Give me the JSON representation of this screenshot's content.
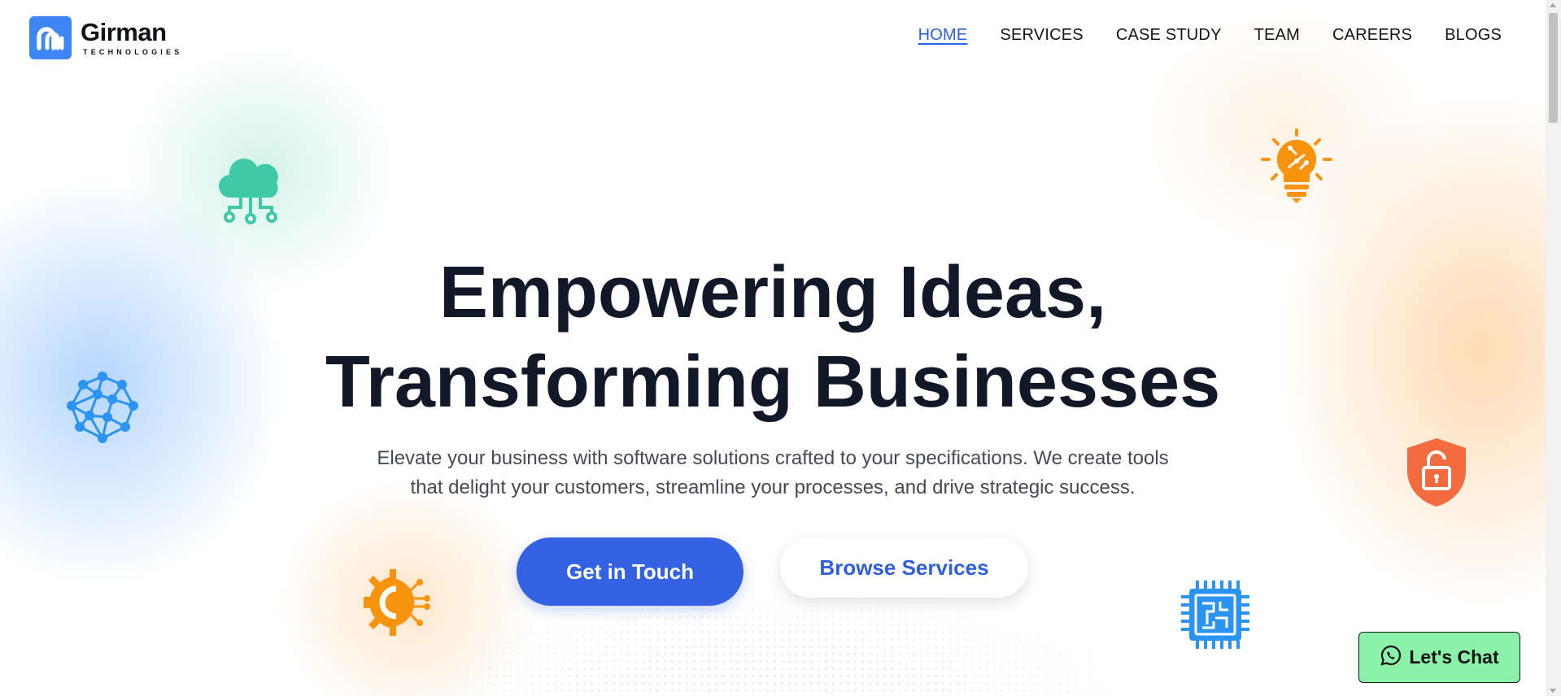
{
  "brand": {
    "name": "Girman",
    "tagline": "TECHNOLOGIES",
    "logo_color": "#3d86f5"
  },
  "nav": {
    "items": [
      {
        "label": "HOME",
        "active": true
      },
      {
        "label": "SERVICES",
        "active": false
      },
      {
        "label": "CASE STUDY",
        "active": false
      },
      {
        "label": "TEAM",
        "active": false
      },
      {
        "label": "CAREERS",
        "active": false
      },
      {
        "label": "BLOGS",
        "active": false
      }
    ],
    "active_color": "#2f5fe0"
  },
  "hero": {
    "title_line1": "Empowering Ideas,",
    "title_line2": "Transforming Businesses",
    "subtitle_line1": "Elevate your business with software solutions crafted to your specifications. We create tools",
    "subtitle_line2": "that delight your customers, streamline your processes, and drive strategic success.",
    "primary_button": "Get in Touch",
    "secondary_button": "Browse Services"
  },
  "decor_icons": [
    {
      "name": "cloud-network-icon",
      "color": "#3ec9a7"
    },
    {
      "name": "neural-network-icon",
      "color": "#2b93f0"
    },
    {
      "name": "gear-circuit-icon",
      "color": "#f7930c"
    },
    {
      "name": "lightbulb-circuit-icon",
      "color": "#f7930c"
    },
    {
      "name": "unlocked-shield-icon",
      "color": "#f26c3f"
    },
    {
      "name": "processor-chip-icon",
      "color": "#2b93f0"
    }
  ],
  "chat": {
    "label": "Let's Chat",
    "background": "#8bf0a8"
  },
  "colors": {
    "primary": "#3362e2",
    "heading": "#111827",
    "body_text": "#444a55"
  }
}
